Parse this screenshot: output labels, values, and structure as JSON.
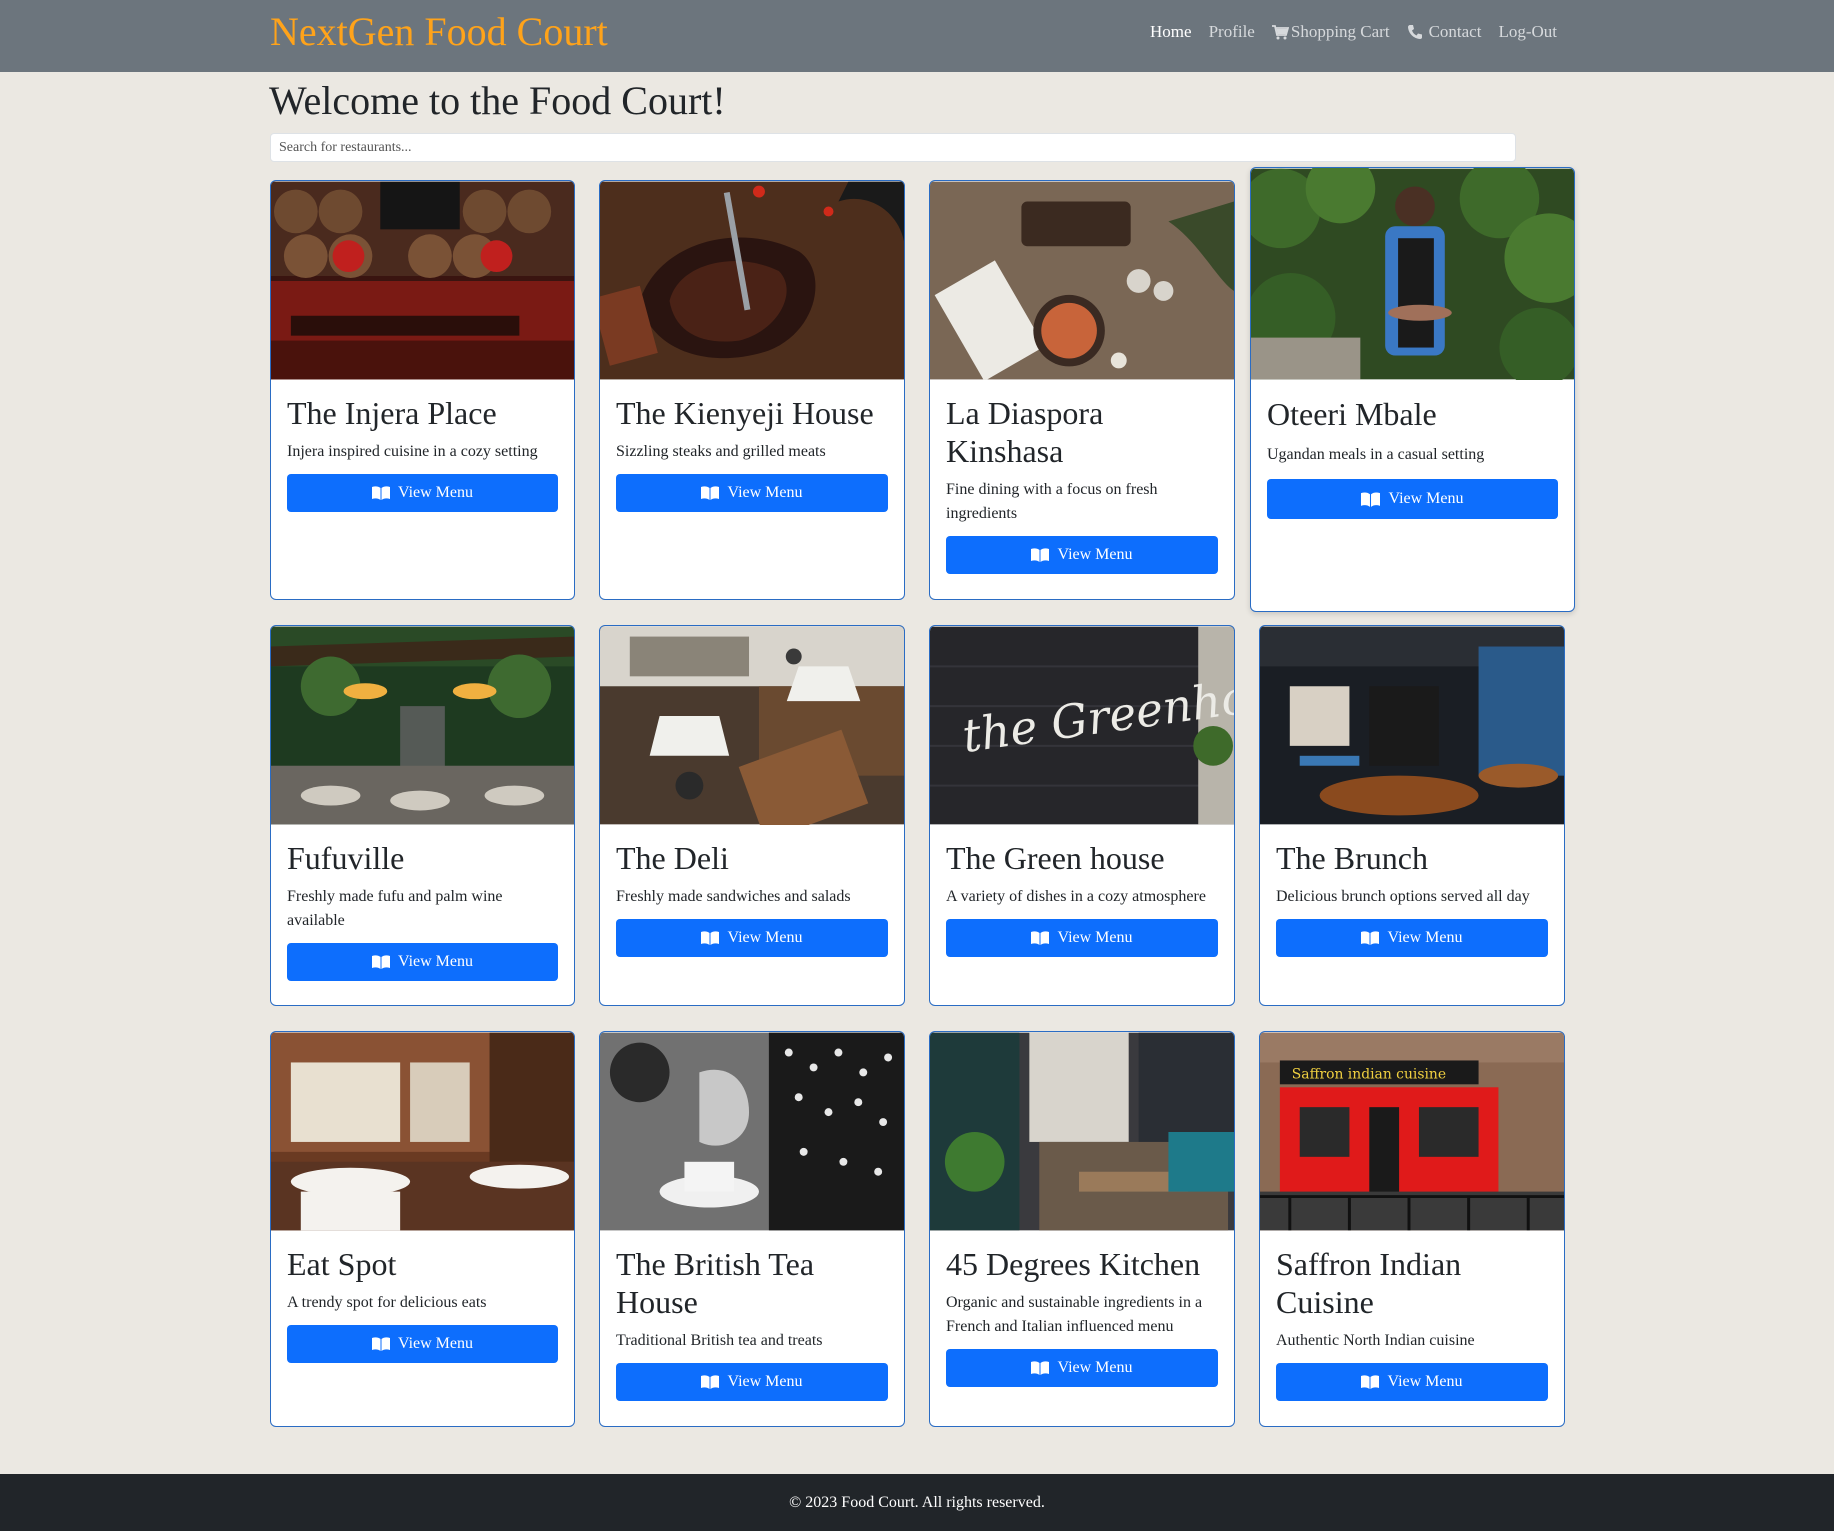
{
  "navbar": {
    "brand": "NextGen Food Court",
    "links": [
      {
        "label": "Home",
        "active": true
      },
      {
        "label": "Profile"
      },
      {
        "label": "Shopping Cart",
        "icon": "cart-icon"
      },
      {
        "label": "Contact",
        "icon": "phone-icon"
      },
      {
        "label": "Log-Out"
      }
    ]
  },
  "header": {
    "title": "Welcome to the Food Court!"
  },
  "search": {
    "placeholder": "Search for restaurants..."
  },
  "button_label": "View Menu",
  "restaurants": [
    {
      "name": "The Injera Place",
      "description": "Injera inspired cuisine in a cozy setting"
    },
    {
      "name": "The Kienyeji House",
      "description": "Sizzling steaks and grilled meats"
    },
    {
      "name": "La Diaspora Kinshasa",
      "description": "Fine dining with a focus on fresh ingredients"
    },
    {
      "name": "Oteeri Mbale",
      "description": "Ugandan meals in a casual setting"
    },
    {
      "name": "Fufuville",
      "description": "Freshly made fufu and palm wine available"
    },
    {
      "name": "The Deli",
      "description": "Freshly made sandwiches and salads"
    },
    {
      "name": "The Green house",
      "description": "A variety of dishes in a cozy atmosphere",
      "image_text": "the Greenhouse"
    },
    {
      "name": "The Brunch",
      "description": "Delicious brunch options served all day"
    },
    {
      "name": "Eat Spot",
      "description": "A trendy spot for delicious eats"
    },
    {
      "name": "The British Tea House",
      "description": "Traditional British tea and treats"
    },
    {
      "name": "45 Degrees Kitchen",
      "description": "Organic and sustainable ingredients in a French and Italian influenced menu"
    },
    {
      "name": "Saffron Indian Cuisine",
      "description": "Authentic North Indian cuisine",
      "image_text": "Saffron indian cuisine"
    }
  ],
  "footer": {
    "text": "© 2023 Food Court. All rights reserved."
  },
  "colors": {
    "navbar": "#6c757d",
    "brand": "#ffa31a",
    "accent": "#0d6efd",
    "card_border": "#2a6cc4",
    "page_bg": "#ebe8e2",
    "footer": "#212529"
  }
}
